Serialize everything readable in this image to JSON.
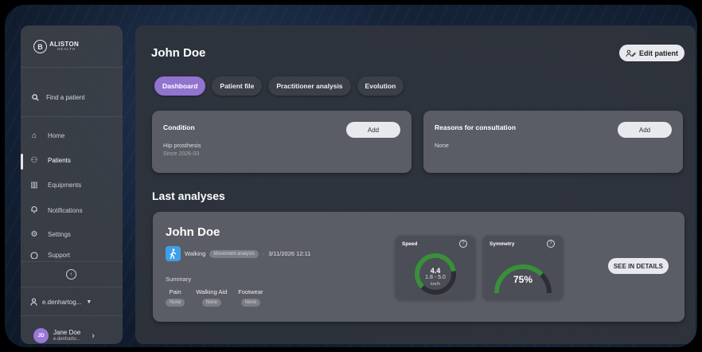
{
  "brand": {
    "mark": "B",
    "name": "ALISTON",
    "sub": "HEALTH"
  },
  "sidebar": {
    "search_label": "Find a patient",
    "items": [
      {
        "label": "Home",
        "icon": "home-icon",
        "glyph": "⌂"
      },
      {
        "label": "Patients",
        "icon": "patients-icon",
        "glyph": "⚇"
      },
      {
        "label": "Equipments",
        "icon": "equipments-icon",
        "glyph": "▥"
      },
      {
        "label": "Notifications",
        "icon": "bell-icon",
        "glyph": "♫"
      },
      {
        "label": "Settings",
        "icon": "gear-icon",
        "glyph": "⚙"
      },
      {
        "label": "Support",
        "icon": "help-icon",
        "glyph": "?"
      }
    ],
    "active_item": "Patients",
    "account_label": "e.denhartog...",
    "profile": {
      "initials": "JD",
      "name": "Jane Doe",
      "email": "e.denharto..."
    }
  },
  "header": {
    "title": "John Doe",
    "edit_label": "Edit patient"
  },
  "tabs": [
    {
      "label": "Dashboard",
      "active": true
    },
    {
      "label": "Patient file",
      "active": false
    },
    {
      "label": "Practitioner analysis",
      "active": false
    },
    {
      "label": "Evolution",
      "active": false
    }
  ],
  "condition": {
    "title": "Condition",
    "add_label": "Add",
    "value": "Hip prosthesis",
    "since": "Since 2026-03"
  },
  "reasons": {
    "title": "Reasons for consultation",
    "add_label": "Add",
    "value": "None"
  },
  "analyses": {
    "section_title": "Last analyses",
    "item": {
      "name": "John Doe",
      "activity": "Walking",
      "type_badge": "Movement analysis",
      "separator": "·",
      "datetime": "3/11/2026 12:11",
      "summary_label": "Summary",
      "summary": [
        {
          "label": "Pain",
          "value": "None"
        },
        {
          "label": "Walking Aid",
          "value": "None"
        },
        {
          "label": "Footwear",
          "value": "None"
        }
      ],
      "speed": {
        "title": "Speed",
        "value": "4.4",
        "range": "1.8 - 5.0",
        "unit": "km/h",
        "fill": 0.8
      },
      "symmetry": {
        "title": "Symmetry",
        "value": "75%",
        "fill": 0.75
      },
      "details_label": "SEE IN DETAILS"
    }
  },
  "colors": {
    "accent": "#9273d0",
    "gauge_fill": "#3a8f3a",
    "gauge_track": "#2c2e33",
    "badge_walk": "#3ea0e8"
  }
}
